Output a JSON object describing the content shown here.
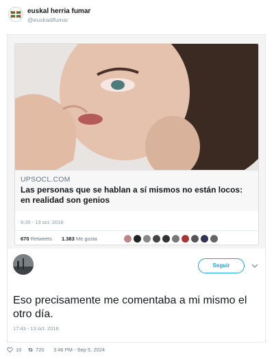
{
  "author": {
    "display_name": "euskal herria fumar",
    "handle": "@euskadifumar"
  },
  "original_tweet": {
    "link_domain": "UPSOCL.COM",
    "link_title": "Las personas que se hablan a sí mismos no están locos: en realidad son genios",
    "timestamp": "9:35 - 13 oct. 2018",
    "retweets_count": "670",
    "retweets_label": "Retweets",
    "likes_count": "1.383",
    "likes_label": "Me gusta"
  },
  "reply_tweet": {
    "follow_label": "Seguir",
    "text": "Eso precisamente me comentaba a mi mismo el otro día.",
    "timestamp": "17:43 - 13 oct. 2018"
  },
  "footer": {
    "likes": "10",
    "retweets": "720",
    "datetime": "3:46 PM - Sep 5, 2024"
  },
  "icons": {
    "like": "heart-icon",
    "retweet": "retweet-icon",
    "caret": "chevron-down-icon"
  },
  "colors": {
    "accent": "#1da1f2",
    "muted": "#657786"
  }
}
